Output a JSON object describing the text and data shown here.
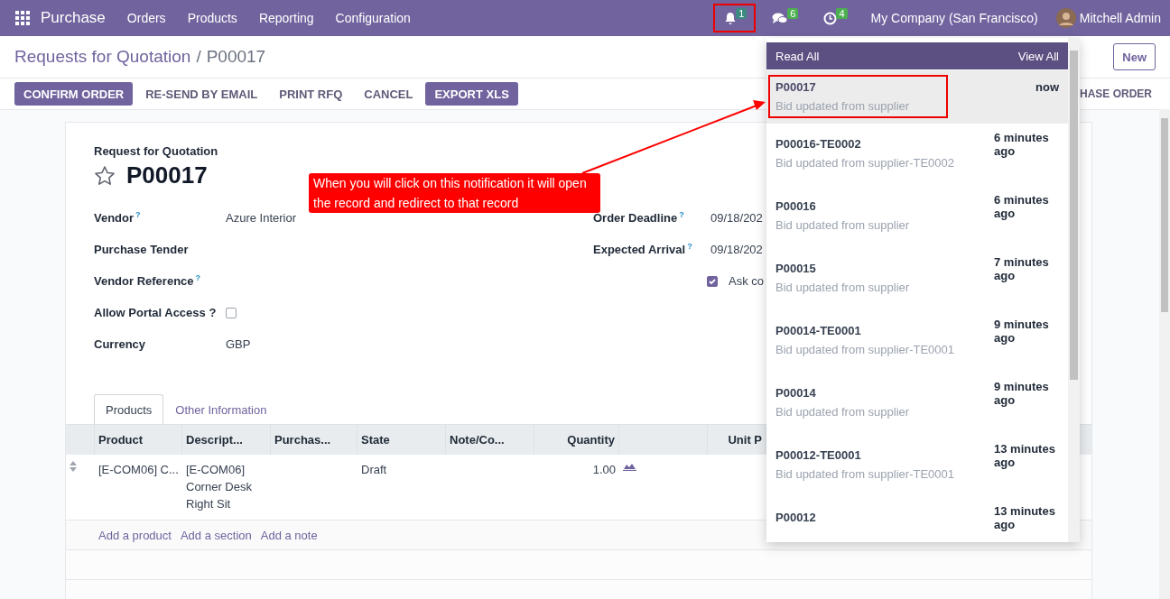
{
  "navbar": {
    "app": "Purchase",
    "menu": [
      "Orders",
      "Products",
      "Reporting",
      "Configuration"
    ],
    "systray": [
      {
        "kind": "bell",
        "count": "1",
        "highlighted": true
      },
      {
        "kind": "chat",
        "count": "6",
        "highlighted": false
      },
      {
        "kind": "clock",
        "count": "4",
        "highlighted": false
      }
    ],
    "company": "My Company (San Francisco)",
    "user": "Mitchell Admin"
  },
  "breadcrumb": {
    "parent": "Requests for Quotation",
    "separator": "/",
    "current": "P00017"
  },
  "new_button": "New",
  "actions": [
    {
      "label": "CONFIRM ORDER",
      "primary": true
    },
    {
      "label": "RE-SEND BY EMAIL",
      "primary": false
    },
    {
      "label": "PRINT RFQ",
      "primary": false
    },
    {
      "label": "CANCEL",
      "primary": false
    },
    {
      "label": "EXPORT XLS",
      "primary": true
    }
  ],
  "status_text": "HASE ORDER",
  "form": {
    "subtitle": "Request for Quotation",
    "title": "P00017",
    "starred": false,
    "left_fields": [
      {
        "kind": "text",
        "label": "Vendor",
        "help": "?",
        "value": "Azure Interior"
      },
      {
        "kind": "text",
        "label": "Purchase Tender"
      },
      {
        "kind": "text",
        "label": "Vendor Reference",
        "help": "?"
      },
      {
        "kind": "checkbox",
        "label": "Allow Portal Access ?",
        "checked": false
      },
      {
        "kind": "text",
        "label": "Currency",
        "value": "GBP"
      }
    ],
    "right_fields": [
      {
        "kind": "text",
        "label": "Order Deadline",
        "help": "?",
        "value": "09/18/202"
      },
      {
        "kind": "text",
        "label": "Expected Arrival",
        "help": "?",
        "value": "09/18/202"
      },
      {
        "kind": "checkbox",
        "label": "Ask co",
        "checked": true
      }
    ],
    "tabs": [
      {
        "label": "Products",
        "selected": true
      },
      {
        "label": "Other Information",
        "selected": false
      }
    ],
    "table": {
      "columns": [
        {
          "kind": "text",
          "label": "Product"
        },
        {
          "kind": "text",
          "label": "Descript..."
        },
        {
          "kind": "text",
          "label": "Purchas..."
        },
        {
          "kind": "text",
          "label": "State"
        },
        {
          "kind": "text",
          "label": "Note/Co..."
        },
        {
          "kind": "number",
          "label": "Quantity"
        },
        {
          "kind": "icon"
        },
        {
          "kind": "number",
          "label": "Unit P"
        }
      ],
      "rows": [
        {
          "product": "[E-COM06] C...",
          "description": "[E-COM06] Corner Desk Right Sit",
          "state": "Draft",
          "quantity": "1.00"
        }
      ],
      "add_links": [
        "Add a product",
        "Add a section",
        "Add a note"
      ]
    }
  },
  "notifications": {
    "read_all": "Read All",
    "view_all": "View All",
    "items": [
      {
        "title": "P00017",
        "message": "Bid updated from supplier",
        "time": "now",
        "selected": true
      },
      {
        "title": "P00016-TE0002",
        "message": "Bid updated from supplier-TE0002",
        "time": "6 minutes ago",
        "selected": false
      },
      {
        "title": "P00016",
        "message": "Bid updated from supplier",
        "time": "6 minutes ago",
        "selected": false
      },
      {
        "title": "P00015",
        "message": "Bid updated from supplier",
        "time": "7 minutes ago",
        "selected": false
      },
      {
        "title": "P00014-TE0001",
        "message": "Bid updated from supplier-TE0001",
        "time": "9 minutes ago",
        "selected": false
      },
      {
        "title": "P00014",
        "message": "Bid updated from supplier",
        "time": "9 minutes ago",
        "selected": false
      },
      {
        "title": "P00012-TE0001",
        "message": "Bid updated from supplier-TE0001",
        "time": "13 minutes ago",
        "selected": false
      },
      {
        "title": "P00012",
        "time": "13 minutes ago",
        "selected": false
      }
    ]
  },
  "annotation": {
    "text": "When you will click on this notification it will open the record and redirect to that record"
  }
}
